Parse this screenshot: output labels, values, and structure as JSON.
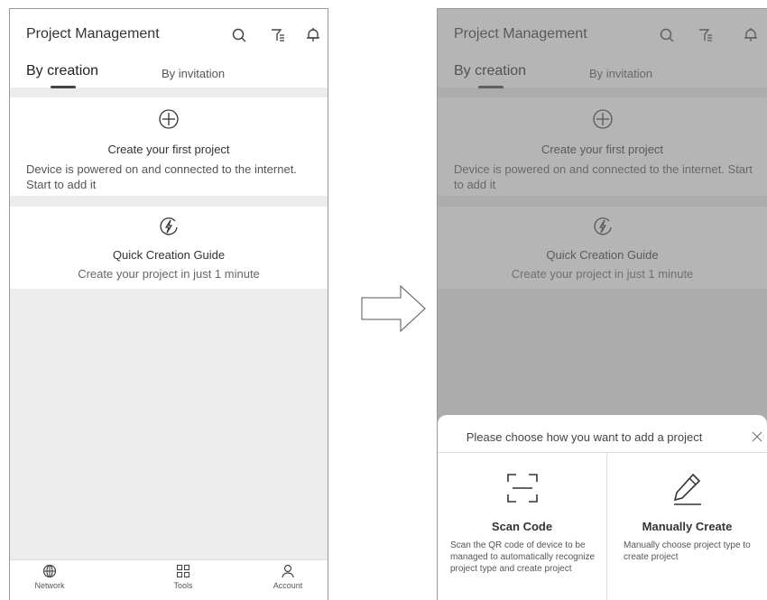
{
  "header": {
    "title": "Project Management",
    "icons": [
      "search-icon",
      "filter-icon",
      "bell-icon"
    ]
  },
  "tabs": {
    "active": "By creation",
    "inactive": "By invitation"
  },
  "create_card": {
    "icon": "plus-circle-icon",
    "title": "Create your first project",
    "description": "Device is powered on and connected to the internet. Start to add it"
  },
  "guide_card": {
    "icon": "lightning-circle-icon",
    "title": "Quick Creation Guide",
    "subtitle": "Create your project in just 1 minute"
  },
  "tabbar": {
    "items": [
      {
        "label": "Network",
        "icon": "globe-icon"
      },
      {
        "label": "Tools",
        "icon": "grid-icon"
      },
      {
        "label": "Account",
        "icon": "person-icon"
      }
    ]
  },
  "sheet": {
    "title": "Please choose how you want to add a project",
    "options": [
      {
        "title": "Scan Code",
        "icon": "scan-icon",
        "description": "Scan the QR code of device to be managed to automatically recognize project type and create project"
      },
      {
        "title": "Manually Create",
        "icon": "pencil-icon",
        "description": "Manually choose project type to create project"
      }
    ]
  },
  "colors": {
    "background": "#ececec",
    "overlay": "#787878",
    "text": "#333333"
  }
}
